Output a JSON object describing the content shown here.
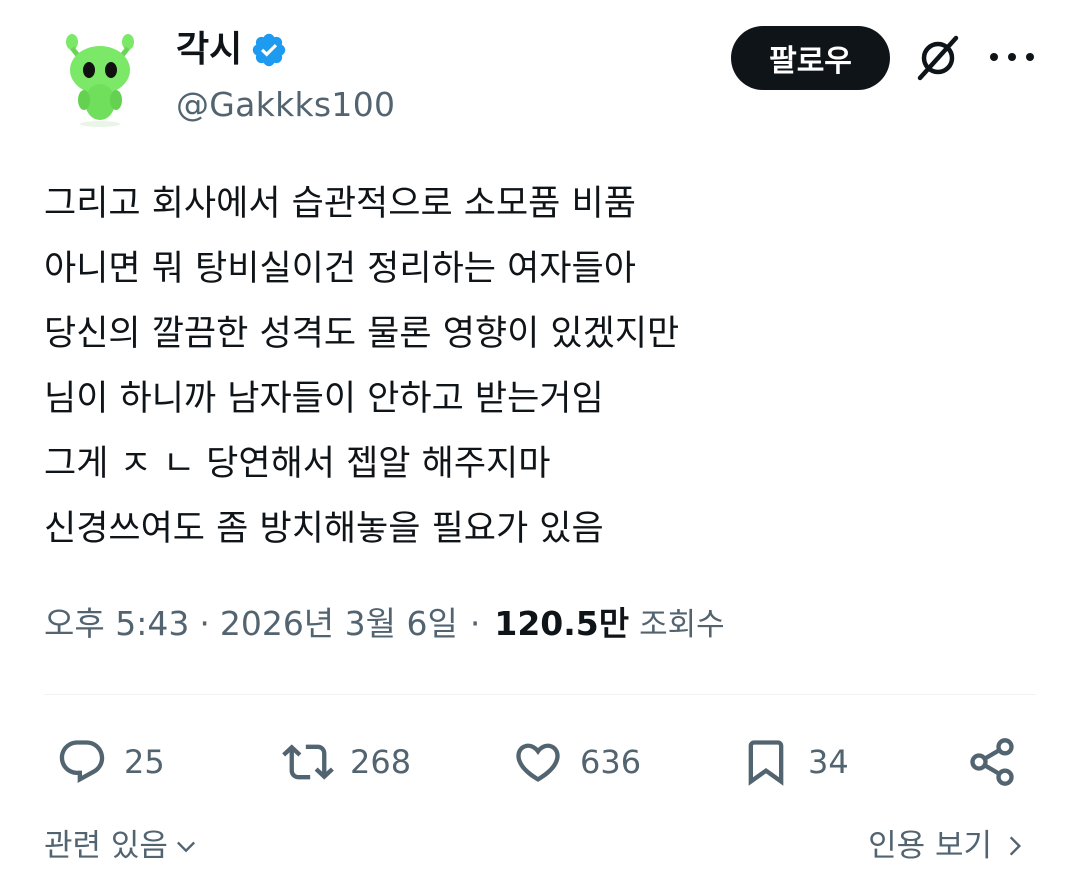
{
  "user": {
    "display_name": "각시",
    "handle": "@Gakkks100",
    "avatar_icon": "green-alien-avatar",
    "verified_color": "#1d9bf0"
  },
  "header": {
    "follow_label": "팔로우",
    "grok_icon": "grok-icon",
    "more_icon": "more-icon"
  },
  "tweet": {
    "lines": [
      "그리고 회사에서 습관적으로 소모품 비품",
      "아니면 뭐 탕비실이건 정리하는 여자들아",
      "당신의 깔끔한 성격도 물론 영향이 있겠지만",
      "님이 하니까 남자들이 안하고 받는거임",
      "그게 ㅈ ㄴ 당연해서 젭알 해주지마",
      "신경쓰여도 좀 방치해놓을 필요가 있음"
    ]
  },
  "meta": {
    "time": "오후 5:43",
    "date": "2026년 3월 6일",
    "separator": "·",
    "views_count": "120.5만",
    "views_label": "조회수"
  },
  "actions": {
    "reply_count": "25",
    "retweet_count": "268",
    "like_count": "636",
    "bookmark_count": "34"
  },
  "footer": {
    "related_label": "관련 있음",
    "quotes_label": "인용 보기"
  },
  "colors": {
    "text": "#0f1419",
    "secondary": "#536471",
    "alien_green": "#6ee05a"
  }
}
